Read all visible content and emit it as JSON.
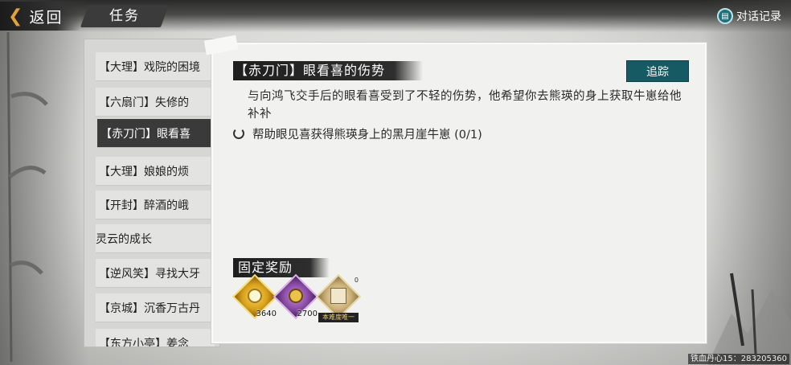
{
  "header": {
    "back_label": "返回",
    "title": "任务",
    "dialog_log_label": "对话记录"
  },
  "task_list": [
    {
      "label": "【大理】戏院的困境",
      "active": false
    },
    {
      "label": "【六扇门】失修的",
      "active": false
    },
    {
      "label": "【赤刀门】眼看喜",
      "active": true
    },
    {
      "label": "【大理】娘娘的烦",
      "active": false
    },
    {
      "label": "【开封】醉酒的峨",
      "active": false
    },
    {
      "label": "灵云的成长",
      "active": false
    },
    {
      "label": "【逆风笑】寻找大牙",
      "active": false
    },
    {
      "label": "【京城】沉香万古丹",
      "active": false
    },
    {
      "label": "【东方小亭】姜念",
      "active": false
    }
  ],
  "quest": {
    "title": "【赤刀门】眼看喜的伤势",
    "track_label": "追踪",
    "description": "与向鸿飞交手后的眼看喜受到了不轻的伤势，他希望你去熊瑛的身上获取牛崽给他补补",
    "objective": "帮助眼见喜获得熊瑛身上的黑月崖牛崽 (0/1)"
  },
  "rewards": {
    "title": "固定奖励",
    "items": [
      {
        "icon": "gold-coin-gem-icon",
        "count": "3640"
      },
      {
        "icon": "copper-coin-gem-icon",
        "count": "2700"
      },
      {
        "icon": "skill-book-icon",
        "count": "0",
        "label": "本难度唯一"
      }
    ]
  },
  "footer": {
    "player_info": "铁血丹心15：283205360"
  }
}
